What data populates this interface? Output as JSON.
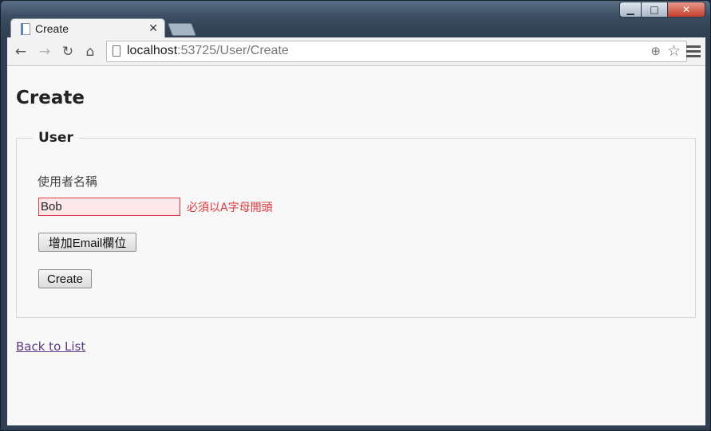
{
  "browser": {
    "tab_title": "Create",
    "url_host": "localhost",
    "url_rest": ":53725/User/Create"
  },
  "page": {
    "title": "Create",
    "legend": "User",
    "field_label": "使用者名稱",
    "name_value": "Bob",
    "error_message": "必須以A字母開頭",
    "add_email_button": "增加Email欄位",
    "create_button": "Create",
    "back_link": "Back to List"
  },
  "colors": {
    "error": "#e0383f",
    "link": "#5b3a85"
  }
}
